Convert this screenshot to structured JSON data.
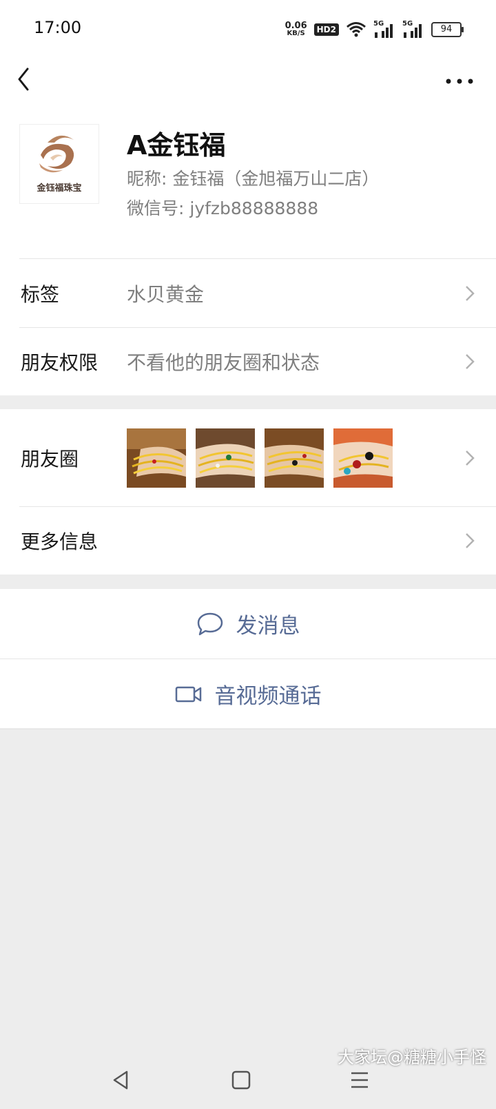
{
  "status_bar": {
    "time": "17:00",
    "net_speed": "0.06",
    "net_unit": "KB/S",
    "hd_badge": "HD2",
    "signal1_label": "5G",
    "signal2_label": "5G",
    "battery": "94"
  },
  "header": {
    "back_icon": "chevron-left-icon",
    "more_icon": "ellipsis-icon"
  },
  "profile": {
    "avatar_logo_text": "金钰福珠宝",
    "display_name": "A金钰福",
    "nickname": "昵称: 金钰福（金旭福万山二店）",
    "wechat_id": "微信号: jyfzb88888888"
  },
  "info_rows": [
    {
      "label": "标签",
      "value": "水贝黄金"
    },
    {
      "label": "朋友权限",
      "value": "不看他的朋友圈和状态"
    }
  ],
  "moments": {
    "label": "朋友圈",
    "thumbnails": [
      "bracelet-photo",
      "bracelet-photo",
      "bracelet-photo",
      "bracelet-photo"
    ]
  },
  "more_info": {
    "label": "更多信息"
  },
  "actions": {
    "message": "发消息",
    "call": "音视频通话"
  },
  "colors": {
    "link_blue": "#576b95",
    "background": "#ededed"
  },
  "watermark": "大家坛@糖糖小手怪"
}
